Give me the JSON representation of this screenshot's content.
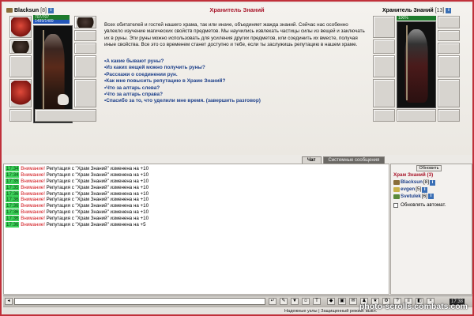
{
  "player": {
    "nick": "Blacksun",
    "level": "[8]",
    "hp": "707/707",
    "mp": "1489/1489"
  },
  "npc": {
    "name": "Хранитель Знаний",
    "level": "[13]",
    "hp": "100%"
  },
  "dialog": {
    "title": "Хранитель Знаний",
    "text": "Всех обитателей и гостей нашего храма, так или иначе, объединяет жажда знаний. Сейчас нас особенно увлекло изучение магических свойств предметов. Мы научились извлекать частицы силы из вещей и заключать их в руны. Эти руны можно использовать для усиления других предметов, или соединить их вместе, получая иные свойства. Все это со временем станет доступно и тебе, если ты заслужишь репутацию в нашем храме.",
    "options": [
      "А какие бывают руны?",
      "Из каких вещей можно получить руны?",
      "Расскажи о соединении рун.",
      "Как мне повысить репутацию в Храме Знаний?",
      "Что за алтарь слева?",
      "Что за алтарь справа?",
      "Спасибо за то, что уделили мне время. (завершить разговор)"
    ]
  },
  "tabs": {
    "chat": "Чат",
    "system": "Системные сообщения"
  },
  "chat": {
    "messages": [
      {
        "time": "17:34",
        "label": "Внимание!",
        "text": " Репутация с \"Храм Знаний\" изменена на +10"
      },
      {
        "time": "17:34",
        "label": "Внимание!",
        "text": " Репутация с \"Храм Знаний\" изменена на +10"
      },
      {
        "time": "17:35",
        "label": "Внимание!",
        "text": " Репутация с \"Храм Знаний\" изменена на +10"
      },
      {
        "time": "17:35",
        "label": "Внимание!",
        "text": " Репутация с \"Храм Знаний\" изменена на +10"
      },
      {
        "time": "17:36",
        "label": "Внимание!",
        "text": " Репутация с \"Храм Знаний\" изменена на +10"
      },
      {
        "time": "17:36",
        "label": "Внимание!",
        "text": " Репутация с \"Храм Знаний\" изменена на +10"
      },
      {
        "time": "17:36",
        "label": "Внимание!",
        "text": " Репутация с \"Храм Знаний\" изменена на +10"
      },
      {
        "time": "17:36",
        "label": "Внимание!",
        "text": " Репутация с \"Храм Знаний\" изменена на +10"
      },
      {
        "time": "17:36",
        "label": "Внимание!",
        "text": " Репутация с \"Храм Знаний\" изменена на +10"
      },
      {
        "time": "17:36",
        "label": "Внимание!",
        "text": " Репутация с \"Храм Знаний\" изменена на +5"
      }
    ]
  },
  "online": {
    "refresh": "Обновить",
    "room": "Храм Знаний (3)",
    "users": [
      {
        "name": "Blacksun",
        "level": "[8]"
      },
      {
        "name": "evgen",
        "level": "[5]"
      },
      {
        "name": "Svetulek",
        "level": "[6]"
      }
    ],
    "auto": "Обновлять автомат."
  },
  "bottom": {
    "clock": "17:38"
  },
  "status": {
    "text": "Надежные узлы | Защищенный режим: выкл."
  },
  "watermark": "photo-scrolls.combats.com"
}
